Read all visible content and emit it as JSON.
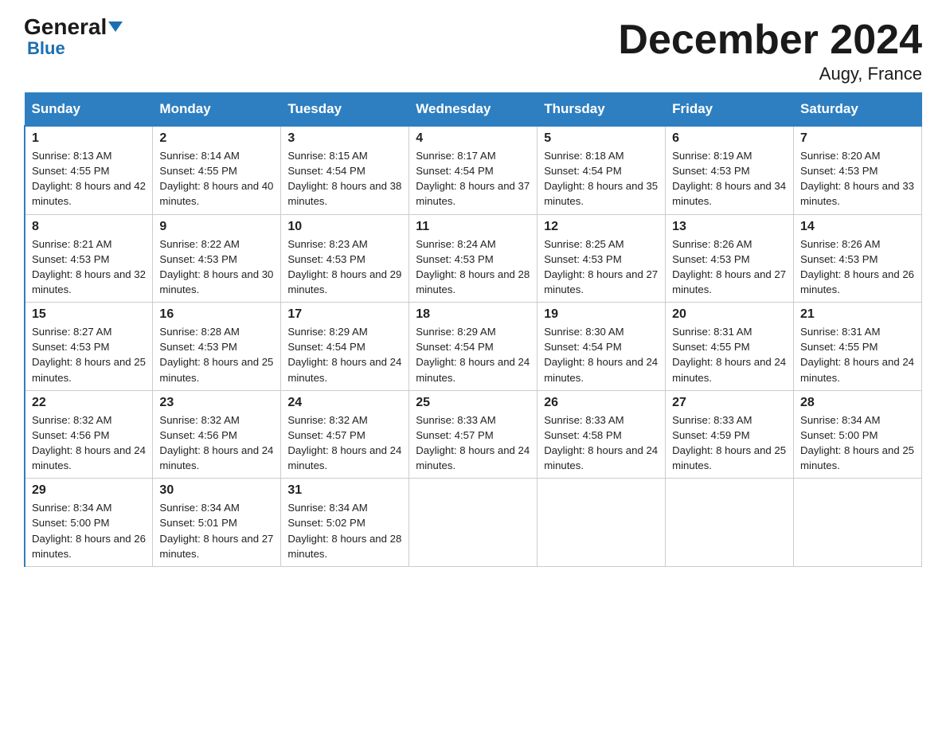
{
  "header": {
    "logo_general": "General",
    "logo_blue": "Blue",
    "title": "December 2024",
    "location": "Augy, France"
  },
  "days_of_week": [
    "Sunday",
    "Monday",
    "Tuesday",
    "Wednesday",
    "Thursday",
    "Friday",
    "Saturday"
  ],
  "weeks": [
    [
      {
        "num": "1",
        "sunrise": "8:13 AM",
        "sunset": "4:55 PM",
        "daylight": "8 hours and 42 minutes."
      },
      {
        "num": "2",
        "sunrise": "8:14 AM",
        "sunset": "4:55 PM",
        "daylight": "8 hours and 40 minutes."
      },
      {
        "num": "3",
        "sunrise": "8:15 AM",
        "sunset": "4:54 PM",
        "daylight": "8 hours and 38 minutes."
      },
      {
        "num": "4",
        "sunrise": "8:17 AM",
        "sunset": "4:54 PM",
        "daylight": "8 hours and 37 minutes."
      },
      {
        "num": "5",
        "sunrise": "8:18 AM",
        "sunset": "4:54 PM",
        "daylight": "8 hours and 35 minutes."
      },
      {
        "num": "6",
        "sunrise": "8:19 AM",
        "sunset": "4:53 PM",
        "daylight": "8 hours and 34 minutes."
      },
      {
        "num": "7",
        "sunrise": "8:20 AM",
        "sunset": "4:53 PM",
        "daylight": "8 hours and 33 minutes."
      }
    ],
    [
      {
        "num": "8",
        "sunrise": "8:21 AM",
        "sunset": "4:53 PM",
        "daylight": "8 hours and 32 minutes."
      },
      {
        "num": "9",
        "sunrise": "8:22 AM",
        "sunset": "4:53 PM",
        "daylight": "8 hours and 30 minutes."
      },
      {
        "num": "10",
        "sunrise": "8:23 AM",
        "sunset": "4:53 PM",
        "daylight": "8 hours and 29 minutes."
      },
      {
        "num": "11",
        "sunrise": "8:24 AM",
        "sunset": "4:53 PM",
        "daylight": "8 hours and 28 minutes."
      },
      {
        "num": "12",
        "sunrise": "8:25 AM",
        "sunset": "4:53 PM",
        "daylight": "8 hours and 27 minutes."
      },
      {
        "num": "13",
        "sunrise": "8:26 AM",
        "sunset": "4:53 PM",
        "daylight": "8 hours and 27 minutes."
      },
      {
        "num": "14",
        "sunrise": "8:26 AM",
        "sunset": "4:53 PM",
        "daylight": "8 hours and 26 minutes."
      }
    ],
    [
      {
        "num": "15",
        "sunrise": "8:27 AM",
        "sunset": "4:53 PM",
        "daylight": "8 hours and 25 minutes."
      },
      {
        "num": "16",
        "sunrise": "8:28 AM",
        "sunset": "4:53 PM",
        "daylight": "8 hours and 25 minutes."
      },
      {
        "num": "17",
        "sunrise": "8:29 AM",
        "sunset": "4:54 PM",
        "daylight": "8 hours and 24 minutes."
      },
      {
        "num": "18",
        "sunrise": "8:29 AM",
        "sunset": "4:54 PM",
        "daylight": "8 hours and 24 minutes."
      },
      {
        "num": "19",
        "sunrise": "8:30 AM",
        "sunset": "4:54 PM",
        "daylight": "8 hours and 24 minutes."
      },
      {
        "num": "20",
        "sunrise": "8:31 AM",
        "sunset": "4:55 PM",
        "daylight": "8 hours and 24 minutes."
      },
      {
        "num": "21",
        "sunrise": "8:31 AM",
        "sunset": "4:55 PM",
        "daylight": "8 hours and 24 minutes."
      }
    ],
    [
      {
        "num": "22",
        "sunrise": "8:32 AM",
        "sunset": "4:56 PM",
        "daylight": "8 hours and 24 minutes."
      },
      {
        "num": "23",
        "sunrise": "8:32 AM",
        "sunset": "4:56 PM",
        "daylight": "8 hours and 24 minutes."
      },
      {
        "num": "24",
        "sunrise": "8:32 AM",
        "sunset": "4:57 PM",
        "daylight": "8 hours and 24 minutes."
      },
      {
        "num": "25",
        "sunrise": "8:33 AM",
        "sunset": "4:57 PM",
        "daylight": "8 hours and 24 minutes."
      },
      {
        "num": "26",
        "sunrise": "8:33 AM",
        "sunset": "4:58 PM",
        "daylight": "8 hours and 24 minutes."
      },
      {
        "num": "27",
        "sunrise": "8:33 AM",
        "sunset": "4:59 PM",
        "daylight": "8 hours and 25 minutes."
      },
      {
        "num": "28",
        "sunrise": "8:34 AM",
        "sunset": "5:00 PM",
        "daylight": "8 hours and 25 minutes."
      }
    ],
    [
      {
        "num": "29",
        "sunrise": "8:34 AM",
        "sunset": "5:00 PM",
        "daylight": "8 hours and 26 minutes."
      },
      {
        "num": "30",
        "sunrise": "8:34 AM",
        "sunset": "5:01 PM",
        "daylight": "8 hours and 27 minutes."
      },
      {
        "num": "31",
        "sunrise": "8:34 AM",
        "sunset": "5:02 PM",
        "daylight": "8 hours and 28 minutes."
      },
      null,
      null,
      null,
      null
    ]
  ]
}
